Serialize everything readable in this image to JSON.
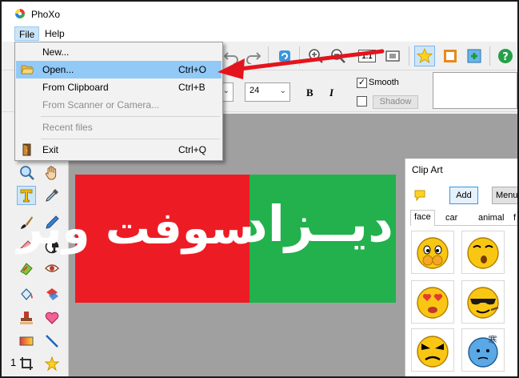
{
  "window": {
    "title": "PhoXo"
  },
  "menubar": {
    "file": "File",
    "help": "Help"
  },
  "file_menu": {
    "new": "New...",
    "open": "Open...",
    "open_shortcut": "Ctrl+O",
    "from_clipboard": "From Clipboard",
    "from_clipboard_shortcut": "Ctrl+B",
    "from_scanner": "From Scanner or Camera...",
    "recent_files": "Recent files",
    "exit": "Exit",
    "exit_shortcut": "Ctrl+Q"
  },
  "fontbar": {
    "font_size": "24",
    "bold": "B",
    "italic": "I",
    "smooth_label": "Smooth",
    "smooth_checked": true,
    "shadow_label": "Shadow",
    "shadow_checked": false
  },
  "toolbar": {
    "actual_size_label": "1:1"
  },
  "canvas": {
    "banner_red_text": "سوفت وير",
    "banner_green_text": "ديــزاد",
    "red_color": "#ed1c24",
    "green_color": "#22b14c"
  },
  "clipart": {
    "title": "Clip Art",
    "add_button": "Add",
    "menu_button": "Menu",
    "tabs": [
      "face",
      "car",
      "animal",
      "f"
    ],
    "emoji_caption": "寒"
  },
  "status": {
    "page_number": "1"
  },
  "colors": {
    "accent": "#3a96dd",
    "menu_highlight": "#91c9f7",
    "arrow": "#e3141c"
  }
}
